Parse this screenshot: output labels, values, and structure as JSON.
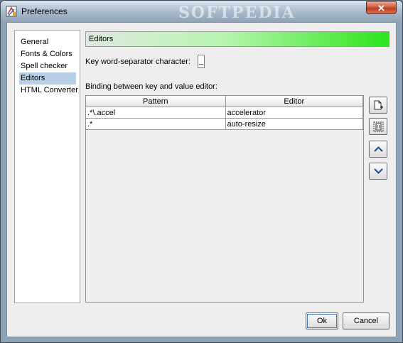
{
  "window": {
    "title": "Preferences",
    "close_label": "✕",
    "watermark": "SOFTPEDIA"
  },
  "sidebar": {
    "items": [
      {
        "label": "General"
      },
      {
        "label": "Fonts & Colors"
      },
      {
        "label": "Spell checker"
      },
      {
        "label": "Editors",
        "selected": true
      },
      {
        "label": "HTML Converter"
      }
    ]
  },
  "panel": {
    "header": "Editors",
    "separator_label": "Key word-separator character:",
    "separator_value": "_",
    "binding_label": "Binding between key and value editor:",
    "table": {
      "columns": [
        "Pattern",
        "Editor"
      ],
      "rows": [
        [
          ".*\\.accel",
          "accelerator"
        ],
        [
          ".*",
          "auto-resize"
        ]
      ]
    }
  },
  "side_buttons": [
    {
      "icon": "add-row-icon"
    },
    {
      "icon": "delete-row-icon"
    },
    {
      "icon": "move-up-icon"
    },
    {
      "icon": "move-down-icon"
    }
  ],
  "footer": {
    "ok_label": "Ok",
    "cancel_label": "Cancel"
  },
  "colors": {
    "header_gradient_end": "#2ee51c",
    "selection": "#b8cfe5"
  }
}
